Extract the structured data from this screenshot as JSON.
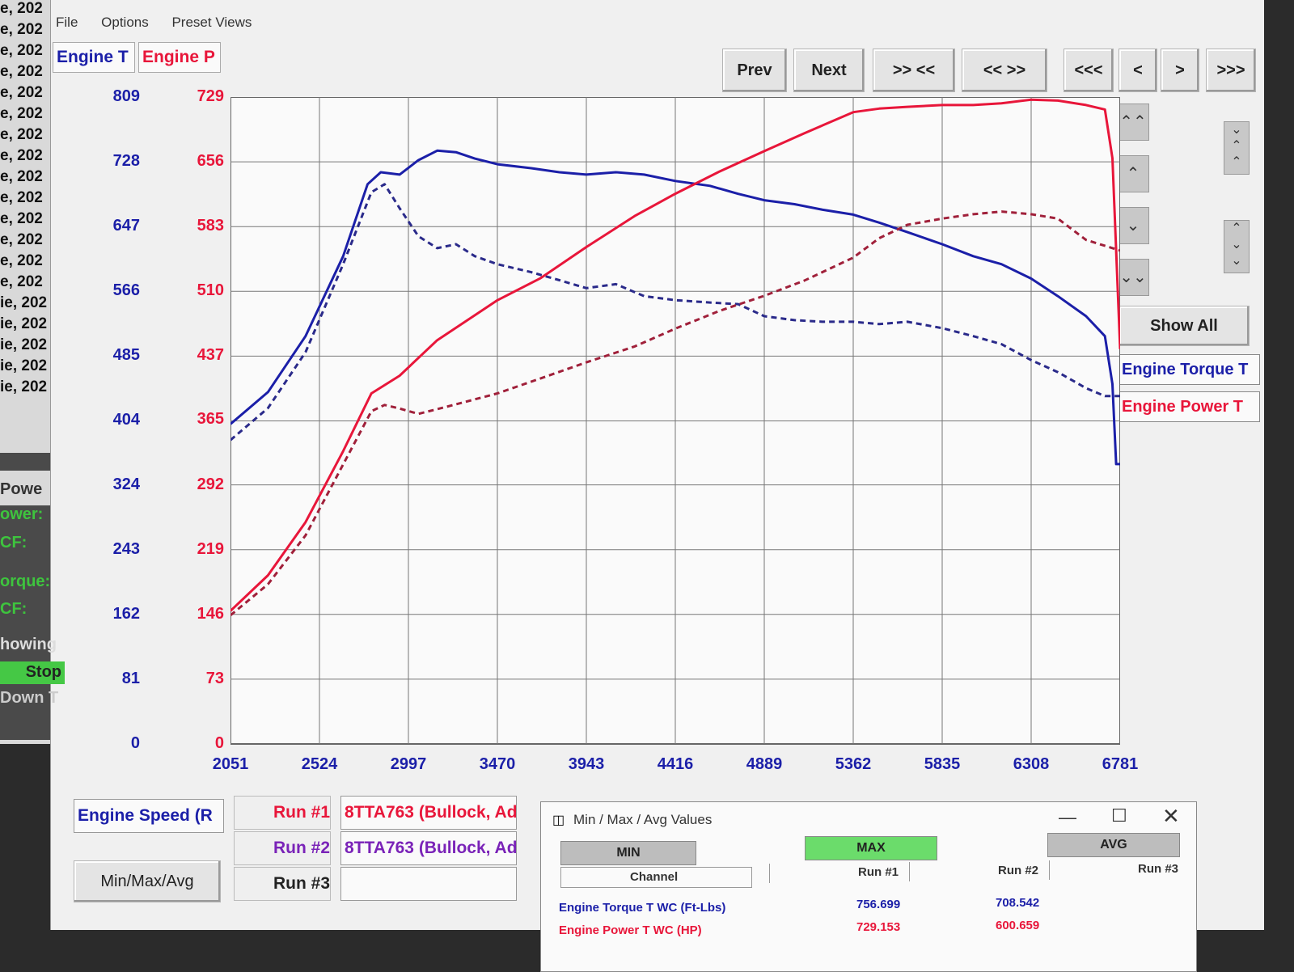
{
  "bg_left": {
    "log_rows": [
      "e, 202",
      "e, 202",
      "e, 202",
      "e, 202",
      "e, 202",
      "e, 202",
      "e, 202",
      "e, 202",
      "e, 202",
      "e, 202",
      "e, 202",
      "e, 202",
      "e, 202",
      "e, 202",
      "ie, 202",
      "ie, 202",
      "ie, 202",
      "ie, 202",
      "ie, 202"
    ],
    "labels": [
      " Powe",
      "ower:",
      "CF:",
      "orque:",
      "CF:",
      "howing",
      "Stop",
      "Down T"
    ]
  },
  "menu": {
    "file": "File",
    "options": "Options",
    "preset_views": "Preset Views"
  },
  "tabs": {
    "torque": "Engine T",
    "power": "Engine P"
  },
  "nav": {
    "prev": "Prev",
    "next": "Next",
    "zoom_in": ">> <<",
    "zoom_out": "<< >>",
    "first": "<<<",
    "back": "<",
    "fwd": ">",
    "last": ">>>"
  },
  "side": {
    "show_all": "Show All",
    "legend_torque": "Engine Torque T",
    "legend_power": "Engine Power T"
  },
  "bottom": {
    "x_channel": "Engine Speed (R",
    "minmax_button": "Min/Max/Avg",
    "run1_label": "Run #1",
    "run1_name": "8TTA763 (Bullock, Ad",
    "run2_label": "Run #2",
    "run2_name": "8TTA763 (Bullock, Ad",
    "run3_label": "Run #3",
    "run3_name": ""
  },
  "dialog": {
    "title": "Min / Max / Avg Values",
    "min": "MIN",
    "max": "MAX",
    "avg": "AVG",
    "channel_hdr": "Channel",
    "run1_hdr": "Run #1",
    "run2_hdr": "Run #2",
    "run3_hdr": "Run #3",
    "rows": [
      {
        "name": "Engine Torque T WC (Ft-Lbs)",
        "run1": "756.699",
        "run2": "708.542"
      },
      {
        "name": "Engine Power T WC (HP)",
        "run1": "729.153",
        "run2": "600.659"
      }
    ]
  },
  "colors": {
    "torque": "#1b1fa8",
    "power": "#e8163a",
    "run2_dash": "#2a2a8a",
    "run2_power_dash": "#a0203a",
    "max_active": "#6bdc6b"
  },
  "chart_data": {
    "type": "line",
    "x_ticks": [
      2051,
      2524,
      2997,
      3470,
      3943,
      4416,
      4889,
      5362,
      5835,
      6308,
      6781
    ],
    "y_left_ticks": [
      0,
      81,
      162,
      243,
      324,
      404,
      485,
      566,
      647,
      728,
      809
    ],
    "y_right_ticks": [
      0,
      73,
      146,
      219,
      292,
      365,
      437,
      510,
      583,
      656,
      729
    ],
    "xlim": [
      2051,
      6781
    ],
    "ylim_left": [
      0,
      809
    ],
    "ylim_right": [
      0,
      729
    ],
    "grid": true,
    "series": [
      {
        "axis": "left",
        "style": "solid",
        "color": "#1b1fa8",
        "x": [
          2051,
          2250,
          2450,
          2650,
          2780,
          2850,
          2950,
          3050,
          3150,
          3250,
          3350,
          3470,
          3650,
          3800,
          3943,
          4100,
          4250,
          4416,
          4600,
          4750,
          4889,
          5050,
          5200,
          5362,
          5500,
          5650,
          5835,
          6000,
          6150,
          6308,
          6450,
          6600,
          6700,
          6740,
          6760,
          6781
        ],
        "y": [
          400,
          440,
          510,
          610,
          700,
          715,
          712,
          730,
          742,
          740,
          732,
          725,
          720,
          715,
          712,
          715,
          712,
          704,
          698,
          688,
          680,
          675,
          668,
          662,
          652,
          640,
          625,
          610,
          600,
          582,
          560,
          535,
          510,
          450,
          350,
          350
        ]
      },
      {
        "axis": "left",
        "style": "dash",
        "color": "#2a2a8a",
        "x": [
          2051,
          2250,
          2450,
          2650,
          2800,
          2870,
          2950,
          3050,
          3150,
          3250,
          3350,
          3470,
          3650,
          3800,
          3943,
          4100,
          4250,
          4416,
          4600,
          4750,
          4889,
          5050,
          5200,
          5362,
          5500,
          5650,
          5835,
          6000,
          6150,
          6308,
          6450,
          6600,
          6700,
          6781
        ],
        "y": [
          380,
          420,
          490,
          600,
          690,
          700,
          670,
          635,
          620,
          625,
          610,
          600,
          590,
          580,
          570,
          575,
          560,
          555,
          552,
          550,
          535,
          530,
          528,
          528,
          525,
          528,
          520,
          510,
          500,
          480,
          465,
          445,
          435,
          435
        ]
      },
      {
        "axis": "right",
        "style": "solid",
        "color": "#e8163a",
        "x": [
          2051,
          2250,
          2450,
          2650,
          2800,
          2950,
          3150,
          3470,
          3700,
          3943,
          4200,
          4416,
          4650,
          4889,
          5100,
          5362,
          5500,
          5650,
          5835,
          6000,
          6150,
          6308,
          6450,
          6600,
          6700,
          6740,
          6781
        ],
        "y": [
          150,
          190,
          250,
          330,
          395,
          415,
          455,
          500,
          525,
          560,
          595,
          620,
          645,
          668,
          688,
          712,
          716,
          718,
          720,
          720,
          722,
          726,
          725,
          720,
          715,
          660,
          445
        ]
      },
      {
        "axis": "right",
        "style": "dash",
        "color": "#a0203a",
        "x": [
          2051,
          2250,
          2450,
          2650,
          2800,
          2870,
          2950,
          3050,
          3200,
          3470,
          3700,
          3943,
          4200,
          4416,
          4650,
          4889,
          5100,
          5362,
          5500,
          5650,
          5835,
          6000,
          6150,
          6308,
          6450,
          6600,
          6781
        ],
        "y": [
          145,
          180,
          235,
          315,
          375,
          382,
          378,
          372,
          380,
          395,
          412,
          430,
          448,
          468,
          488,
          505,
          522,
          548,
          570,
          585,
          592,
          597,
          600,
          597,
          592,
          568,
          556
        ]
      }
    ]
  }
}
